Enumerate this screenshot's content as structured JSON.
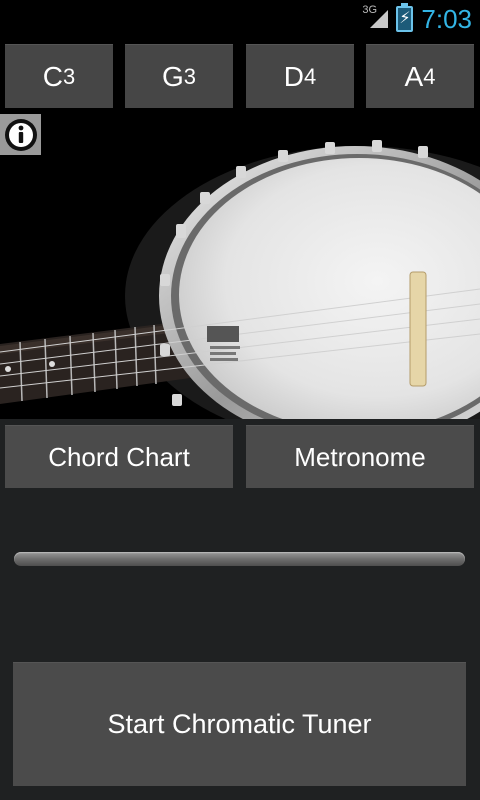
{
  "status_bar": {
    "network": "3G",
    "time": "7:03",
    "icons": [
      "signal-icon",
      "battery-charging-icon"
    ]
  },
  "strings": [
    {
      "note": "C",
      "octave": "3"
    },
    {
      "note": "G",
      "octave": "3"
    },
    {
      "note": "D",
      "octave": "4"
    },
    {
      "note": "A",
      "octave": "4"
    }
  ],
  "info": {
    "icon": "info-icon"
  },
  "buttons": {
    "chord_chart": "Chord Chart",
    "metronome": "Metronome",
    "start_tuner": "Start Chromatic Tuner"
  },
  "tuner_meter": {
    "level": 0
  }
}
